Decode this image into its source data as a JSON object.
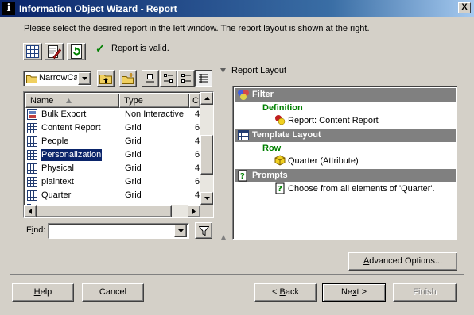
{
  "window": {
    "title": "Information Object Wizard - Report",
    "close_glyph": "X"
  },
  "instructions": "Please select the desired report in the left window. The report layout is shown at the right.",
  "status": {
    "check_glyph": "✓",
    "text": "Report is valid.",
    "color": "#008000"
  },
  "folder_combo": {
    "value": "NarrowCa"
  },
  "list": {
    "columns": [
      {
        "label": "Name"
      },
      {
        "label": "Type"
      },
      {
        "label": "C"
      }
    ],
    "rows": [
      {
        "name": "Bulk Export",
        "type": "Non Interactive",
        "c": "4,",
        "icon": "bulk-export-icon"
      },
      {
        "name": "Content Report",
        "type": "Grid",
        "c": "6,",
        "icon": "grid-report-icon"
      },
      {
        "name": "People",
        "type": "Grid",
        "c": "4,",
        "icon": "grid-report-icon"
      },
      {
        "name": "Personalization",
        "type": "Grid",
        "c": "6,",
        "icon": "grid-report-icon",
        "selected": true
      },
      {
        "name": "Physical",
        "type": "Grid",
        "c": "4,",
        "icon": "grid-report-icon"
      },
      {
        "name": "plaintext",
        "type": "Grid",
        "c": "6,",
        "icon": "grid-report-icon"
      },
      {
        "name": "Quarter",
        "type": "Grid",
        "c": "4,",
        "icon": "grid-report-icon"
      }
    ]
  },
  "find": {
    "label": "Find:",
    "accel": "i",
    "value": ""
  },
  "report_layout": {
    "label": "Report Layout",
    "sections": {
      "filter": {
        "header": "Filter",
        "sub": "Definition",
        "item": "Report: Content Report"
      },
      "template": {
        "header": "Template Layout",
        "sub": "Row",
        "item": "Quarter (Attribute)"
      },
      "prompts": {
        "header": "Prompts",
        "item": "Choose from all elements of 'Quarter'."
      }
    }
  },
  "buttons": {
    "advanced": {
      "label": "Advanced Options..."
    },
    "help": {
      "label": "Help"
    },
    "cancel": {
      "label": "Cancel"
    },
    "back": {
      "label": "< Back"
    },
    "next": {
      "label": "Next >"
    },
    "finish": {
      "label": "Finish",
      "disabled": true
    }
  },
  "colors": {
    "titlebar_start": "#0a246a",
    "dialog_bg": "#d4d0c8",
    "section_header_bg": "#808080",
    "section_sub_color": "#008000"
  }
}
